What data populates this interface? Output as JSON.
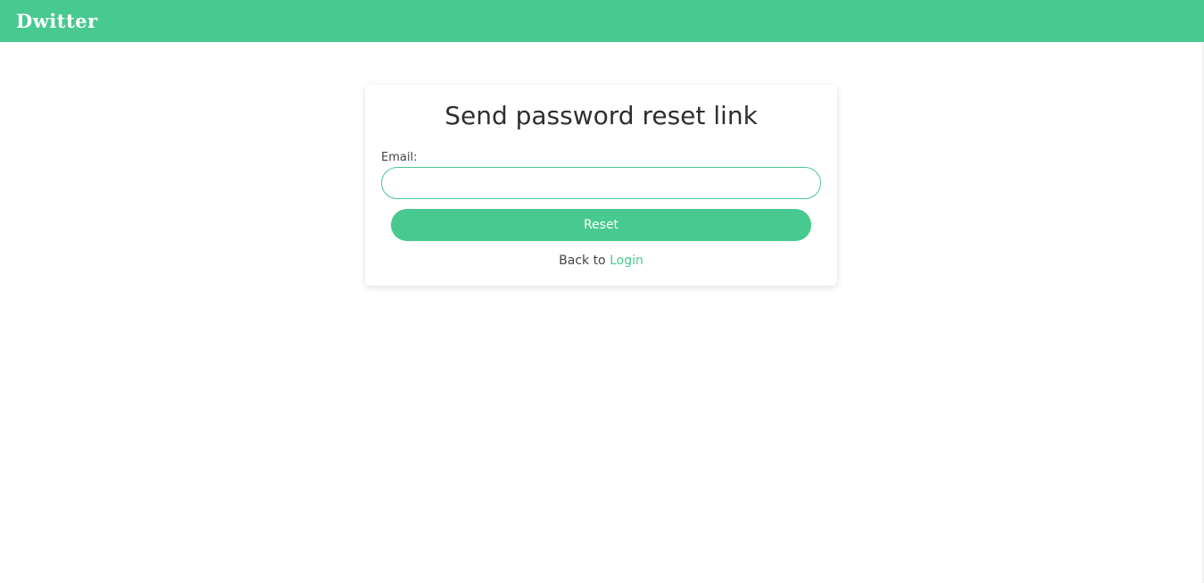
{
  "header": {
    "logo_text": "Dwitter",
    "color": "#48c98f"
  },
  "reset_form": {
    "title": "Send password reset link",
    "email_label": "Email:",
    "email_value": "",
    "email_placeholder": "",
    "submit_label": "Reset",
    "back_text": "Back to",
    "login_link_label": "Login"
  },
  "colors": {
    "accent": "#48c98f",
    "text": "#333333",
    "background": "#ffffff"
  }
}
